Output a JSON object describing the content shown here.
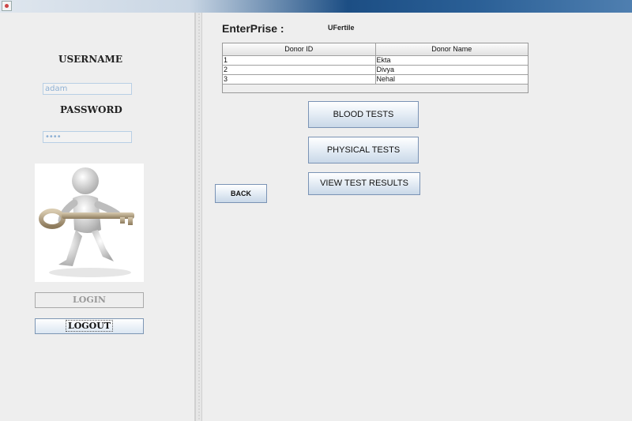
{
  "login": {
    "username_label": "USERNAME",
    "username_value": "adam",
    "password_label": "PASSWORD",
    "password_value": "••••",
    "login_button": "LOGIN",
    "logout_button": "LOGOUT"
  },
  "enterprise": {
    "label": "EnterPrise :",
    "value": "UFertile"
  },
  "donor_table": {
    "columns": [
      "Donor ID",
      "Donor Name"
    ],
    "rows": [
      [
        "1",
        "Ekta"
      ],
      [
        "2",
        "Divya"
      ],
      [
        "3",
        "Nehal"
      ]
    ]
  },
  "actions": {
    "blood_tests": "BLOOD TESTS",
    "physical_tests": "PHYSICAL TESTS",
    "view_test_results": "VIEW TEST RESULTS",
    "back": "BACK"
  },
  "colors": {
    "accent": "#7a93b5",
    "field_border": "#b8cfe5",
    "title_bar": "#1c4e84"
  },
  "icons": {
    "app": "java-app-icon",
    "login_image": "person-holding-key-icon"
  }
}
